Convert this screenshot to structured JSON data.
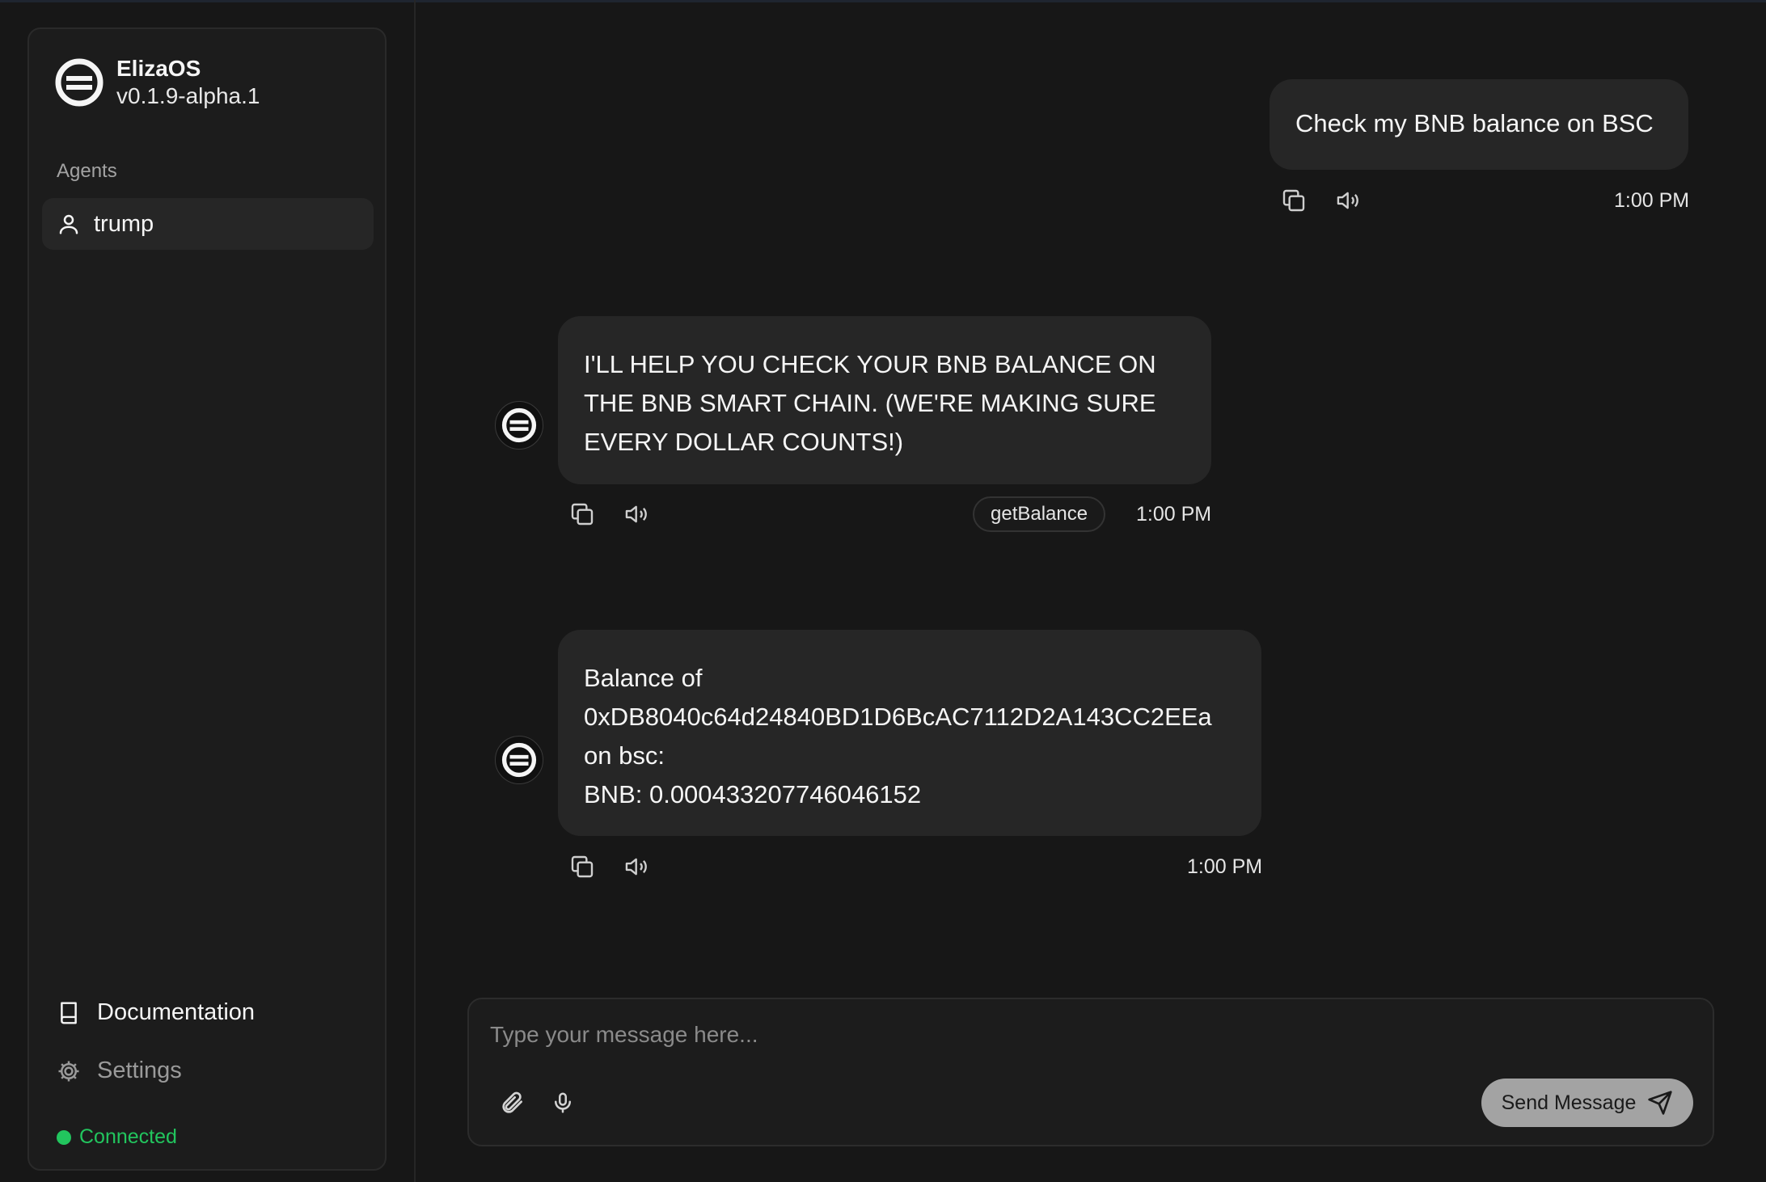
{
  "app": {
    "name": "ElizaOS",
    "version": "v0.1.9-alpha.1"
  },
  "sidebar": {
    "agents_label": "Agents",
    "agents": [
      {
        "name": "trump",
        "icon": "user-icon"
      }
    ],
    "footer": [
      {
        "label": "Documentation",
        "icon": "book-icon"
      },
      {
        "label": "Settings",
        "icon": "gear-icon"
      }
    ],
    "status": {
      "label": "Connected",
      "color": "#22c55e"
    }
  },
  "messages": [
    {
      "role": "user",
      "text": "Check my BNB balance on BSC",
      "time": "1:00 PM"
    },
    {
      "role": "agent",
      "lines": [
        "I'LL HELP YOU CHECK YOUR BNB BALANCE ON",
        "THE BNB SMART CHAIN. (WE'RE MAKING SURE",
        "EVERY DOLLAR COUNTS!)"
      ],
      "action": "getBalance",
      "time": "1:00 PM"
    },
    {
      "role": "agent",
      "lines": [
        "Balance of",
        "0xDB8040c64d24840BD1D6BcAC7112D2A143CC2EEa",
        "on bsc:",
        "BNB: 0.000433207746046152"
      ],
      "time": "1:00 PM"
    }
  ],
  "composer": {
    "placeholder": "Type your message here...",
    "send_label": "Send Message"
  }
}
